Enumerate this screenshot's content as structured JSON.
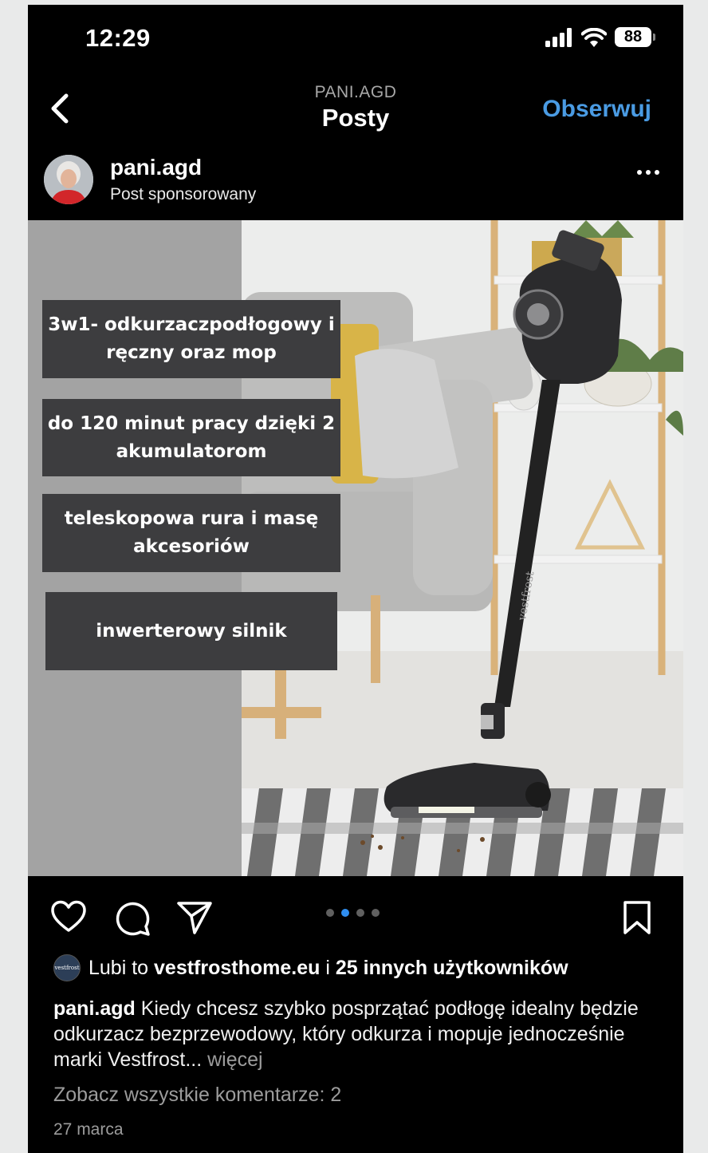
{
  "status_bar": {
    "time": "12:29",
    "battery": "88"
  },
  "nav": {
    "subtitle": "PANI.AGD",
    "title": "Posty",
    "follow_label": "Obserwuj"
  },
  "post": {
    "username": "pani.agd",
    "sponsored_label": "Post sponsorowany",
    "features": [
      "3w1- odkurzaczpodłogowy i ręczny oraz mop",
      "do 120 minut pracy dzięki 2 akumulatorom",
      "teleskopowa rura i masę akcesoriów",
      "inwerterowy silnik"
    ],
    "brand_logo_text": "vestfrost",
    "carousel": {
      "count": 4,
      "active_index": 1
    }
  },
  "likes": {
    "prefix": "Lubi to",
    "user": "vestfrosthome.eu",
    "joiner": "i",
    "others": "25 innych użytkowników",
    "avatar_text": "vestfrost"
  },
  "caption": {
    "username": "pani.agd",
    "text": "Kiedy chcesz szybko posprzątać podłogę idealny będzie odkurzacz bezprzewodowy, który odkurza i mopuje jednocześnie marki Vestfrost...",
    "more": "więcej"
  },
  "comments_link": "Zobacz wszystkie komentarze: 2",
  "date": "27 marca",
  "colors": {
    "accent": "#4a9be3",
    "carousel_active": "#2f8ef0",
    "feature_box": "#3d3d3f"
  }
}
